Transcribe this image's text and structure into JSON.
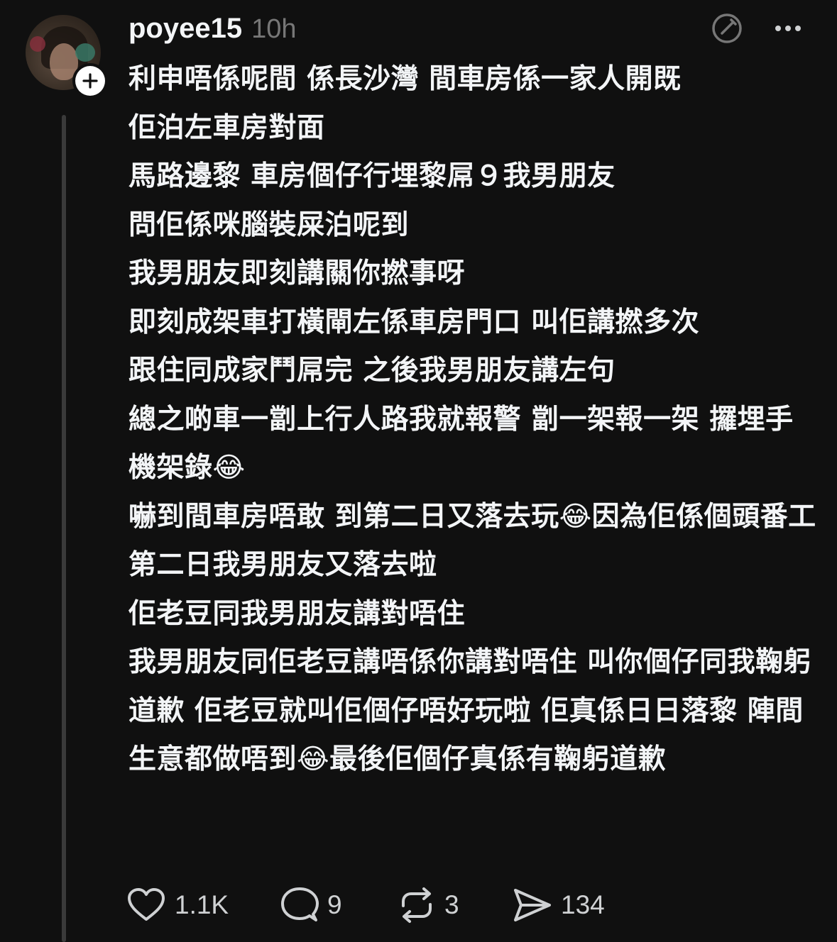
{
  "post": {
    "username": "poyee15",
    "time": "10h",
    "paragraphs": [
      "利申唔係呢間 係長沙灣 間車房係一家人開既",
      "佢泊左車房對面",
      "馬路邊黎 車房個仔行埋黎屌９我男朋友",
      "問佢係咪腦裝屎泊呢到",
      "我男朋友即刻講關你撚事呀",
      "即刻成架車打橫閘左係車房門口 叫佢講撚多次",
      "跟住同成家鬥屌完 之後我男朋友講左句",
      "總之啲車一劏上行人路我就報警 劏一架報一架 攞埋手機架錄😂",
      "嚇到間車房唔敢 到第二日又落去玩😂因為佢係個頭番工",
      "第二日我男朋友又落去啦",
      "佢老豆同我男朋友講對唔住",
      "我男朋友同佢老豆講唔係你講對唔住 叫你個仔同我鞠躬道歉 佢老豆就叫佢個仔唔好玩啦 佢真係日日落黎 陣間生意都做唔到😂最後佢個仔真係有鞠躬道歉"
    ]
  },
  "header_icons": {
    "edit": "edit-circle-icon",
    "more": "more-dots-icon"
  },
  "actions": {
    "like_count": "1.1K",
    "comment_count": "9",
    "repost_count": "3",
    "share_count": "134"
  },
  "colors": {
    "background": "#101010",
    "text": "#f3f5f7",
    "muted": "#777777",
    "thread_line": "#3a3a3a"
  }
}
